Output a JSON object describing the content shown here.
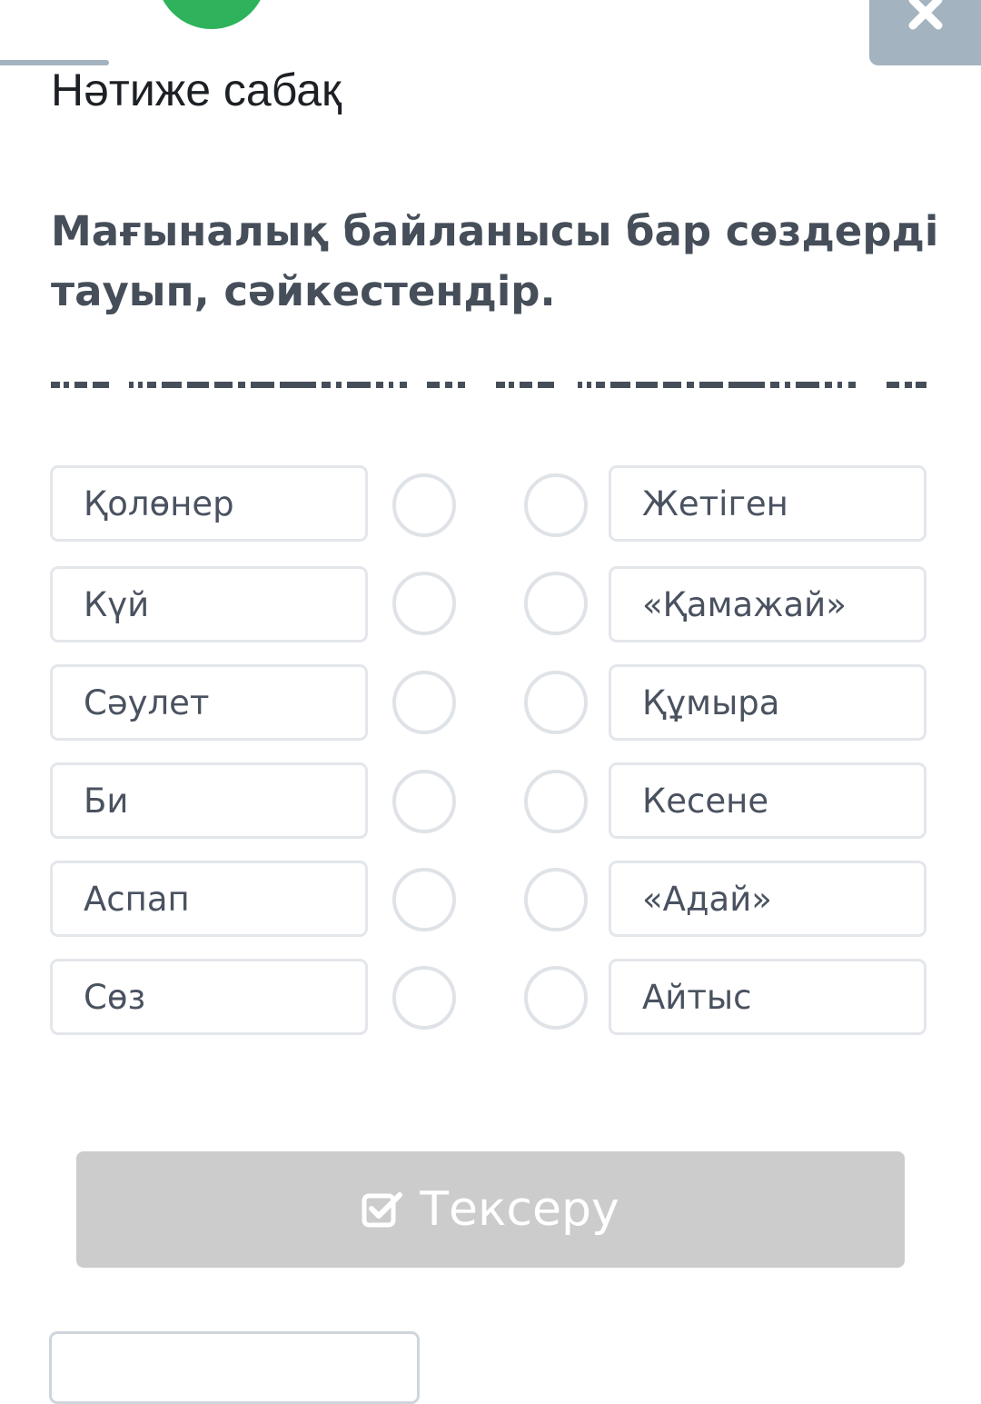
{
  "header": {
    "title": "Нәтиже сабақ",
    "close_icon": "close-icon"
  },
  "question": {
    "text": "Мағыналық байланысы бар сөздерді тауып, сәйкестендір."
  },
  "left_items": [
    {
      "label": "Қолөнер"
    },
    {
      "label": "Күй"
    },
    {
      "label": "Сәулет"
    },
    {
      "label": "Би"
    },
    {
      "label": "Аспап"
    },
    {
      "label": "Сөз"
    }
  ],
  "right_items": [
    {
      "label": "Жетіген"
    },
    {
      "label": "«Қамажай»"
    },
    {
      "label": "Құмыра"
    },
    {
      "label": "Кесене"
    },
    {
      "label": "«Адай»"
    },
    {
      "label": "Айтыс"
    }
  ],
  "check_button": {
    "label": "Тексеру",
    "icon": "checkbox-icon"
  },
  "colors": {
    "accent_green": "#2eb35c",
    "close_bg": "#a3b3bf",
    "button_disabled": "#cccccc",
    "border": "#e3e6ea"
  }
}
